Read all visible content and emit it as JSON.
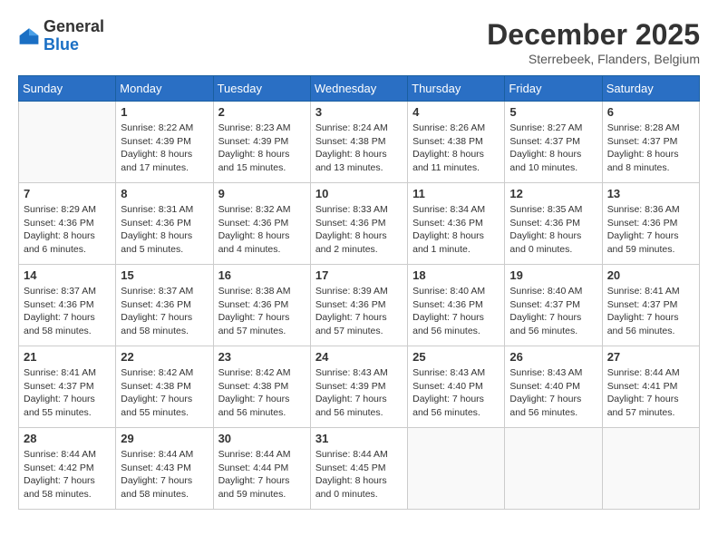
{
  "logo": {
    "general": "General",
    "blue": "Blue"
  },
  "header": {
    "month": "December 2025",
    "location": "Sterrebeek, Flanders, Belgium"
  },
  "weekdays": [
    "Sunday",
    "Monday",
    "Tuesday",
    "Wednesday",
    "Thursday",
    "Friday",
    "Saturday"
  ],
  "weeks": [
    [
      {
        "day": "",
        "info": ""
      },
      {
        "day": "1",
        "info": "Sunrise: 8:22 AM\nSunset: 4:39 PM\nDaylight: 8 hours\nand 17 minutes."
      },
      {
        "day": "2",
        "info": "Sunrise: 8:23 AM\nSunset: 4:39 PM\nDaylight: 8 hours\nand 15 minutes."
      },
      {
        "day": "3",
        "info": "Sunrise: 8:24 AM\nSunset: 4:38 PM\nDaylight: 8 hours\nand 13 minutes."
      },
      {
        "day": "4",
        "info": "Sunrise: 8:26 AM\nSunset: 4:38 PM\nDaylight: 8 hours\nand 11 minutes."
      },
      {
        "day": "5",
        "info": "Sunrise: 8:27 AM\nSunset: 4:37 PM\nDaylight: 8 hours\nand 10 minutes."
      },
      {
        "day": "6",
        "info": "Sunrise: 8:28 AM\nSunset: 4:37 PM\nDaylight: 8 hours\nand 8 minutes."
      }
    ],
    [
      {
        "day": "7",
        "info": "Sunrise: 8:29 AM\nSunset: 4:36 PM\nDaylight: 8 hours\nand 6 minutes."
      },
      {
        "day": "8",
        "info": "Sunrise: 8:31 AM\nSunset: 4:36 PM\nDaylight: 8 hours\nand 5 minutes."
      },
      {
        "day": "9",
        "info": "Sunrise: 8:32 AM\nSunset: 4:36 PM\nDaylight: 8 hours\nand 4 minutes."
      },
      {
        "day": "10",
        "info": "Sunrise: 8:33 AM\nSunset: 4:36 PM\nDaylight: 8 hours\nand 2 minutes."
      },
      {
        "day": "11",
        "info": "Sunrise: 8:34 AM\nSunset: 4:36 PM\nDaylight: 8 hours\nand 1 minute."
      },
      {
        "day": "12",
        "info": "Sunrise: 8:35 AM\nSunset: 4:36 PM\nDaylight: 8 hours\nand 0 minutes."
      },
      {
        "day": "13",
        "info": "Sunrise: 8:36 AM\nSunset: 4:36 PM\nDaylight: 7 hours\nand 59 minutes."
      }
    ],
    [
      {
        "day": "14",
        "info": "Sunrise: 8:37 AM\nSunset: 4:36 PM\nDaylight: 7 hours\nand 58 minutes."
      },
      {
        "day": "15",
        "info": "Sunrise: 8:37 AM\nSunset: 4:36 PM\nDaylight: 7 hours\nand 58 minutes."
      },
      {
        "day": "16",
        "info": "Sunrise: 8:38 AM\nSunset: 4:36 PM\nDaylight: 7 hours\nand 57 minutes."
      },
      {
        "day": "17",
        "info": "Sunrise: 8:39 AM\nSunset: 4:36 PM\nDaylight: 7 hours\nand 57 minutes."
      },
      {
        "day": "18",
        "info": "Sunrise: 8:40 AM\nSunset: 4:36 PM\nDaylight: 7 hours\nand 56 minutes."
      },
      {
        "day": "19",
        "info": "Sunrise: 8:40 AM\nSunset: 4:37 PM\nDaylight: 7 hours\nand 56 minutes."
      },
      {
        "day": "20",
        "info": "Sunrise: 8:41 AM\nSunset: 4:37 PM\nDaylight: 7 hours\nand 56 minutes."
      }
    ],
    [
      {
        "day": "21",
        "info": "Sunrise: 8:41 AM\nSunset: 4:37 PM\nDaylight: 7 hours\nand 55 minutes."
      },
      {
        "day": "22",
        "info": "Sunrise: 8:42 AM\nSunset: 4:38 PM\nDaylight: 7 hours\nand 55 minutes."
      },
      {
        "day": "23",
        "info": "Sunrise: 8:42 AM\nSunset: 4:38 PM\nDaylight: 7 hours\nand 56 minutes."
      },
      {
        "day": "24",
        "info": "Sunrise: 8:43 AM\nSunset: 4:39 PM\nDaylight: 7 hours\nand 56 minutes."
      },
      {
        "day": "25",
        "info": "Sunrise: 8:43 AM\nSunset: 4:40 PM\nDaylight: 7 hours\nand 56 minutes."
      },
      {
        "day": "26",
        "info": "Sunrise: 8:43 AM\nSunset: 4:40 PM\nDaylight: 7 hours\nand 56 minutes."
      },
      {
        "day": "27",
        "info": "Sunrise: 8:44 AM\nSunset: 4:41 PM\nDaylight: 7 hours\nand 57 minutes."
      }
    ],
    [
      {
        "day": "28",
        "info": "Sunrise: 8:44 AM\nSunset: 4:42 PM\nDaylight: 7 hours\nand 58 minutes."
      },
      {
        "day": "29",
        "info": "Sunrise: 8:44 AM\nSunset: 4:43 PM\nDaylight: 7 hours\nand 58 minutes."
      },
      {
        "day": "30",
        "info": "Sunrise: 8:44 AM\nSunset: 4:44 PM\nDaylight: 7 hours\nand 59 minutes."
      },
      {
        "day": "31",
        "info": "Sunrise: 8:44 AM\nSunset: 4:45 PM\nDaylight: 8 hours\nand 0 minutes."
      },
      {
        "day": "",
        "info": ""
      },
      {
        "day": "",
        "info": ""
      },
      {
        "day": "",
        "info": ""
      }
    ]
  ]
}
